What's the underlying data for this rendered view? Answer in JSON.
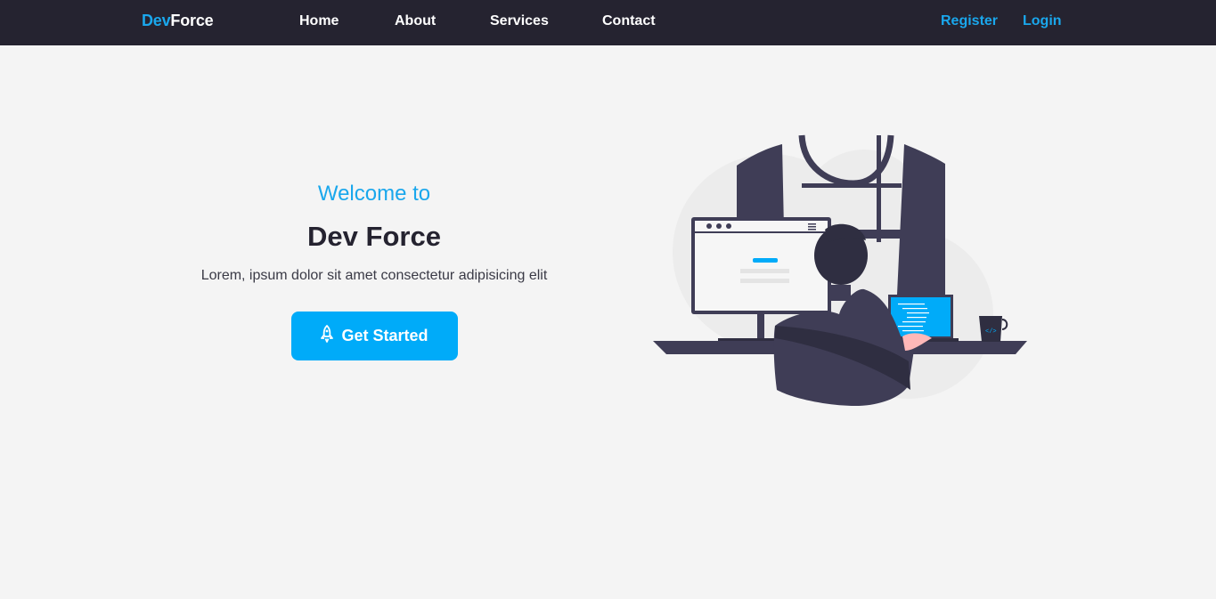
{
  "brand": {
    "part1": "Dev",
    "part2": "Force",
    "accent_color": "#1aa7ec"
  },
  "nav": {
    "links": [
      "Home",
      "About",
      "Services",
      "Contact"
    ],
    "register": "Register",
    "login": "Login"
  },
  "hero": {
    "welcome": "Welcome to",
    "title": "Dev Force",
    "subtitle": "Lorem, ipsum dolor sit amet consectetur adipisicing elit",
    "cta_label": "Get Started",
    "cta_icon": "rocket-icon",
    "cta_color": "#00abf9"
  },
  "illustration": {
    "name": "developer-at-desk-illustration"
  },
  "colors": {
    "navbar": "#252330",
    "background": "#f4f4f4",
    "dark": "#3f3d56"
  }
}
